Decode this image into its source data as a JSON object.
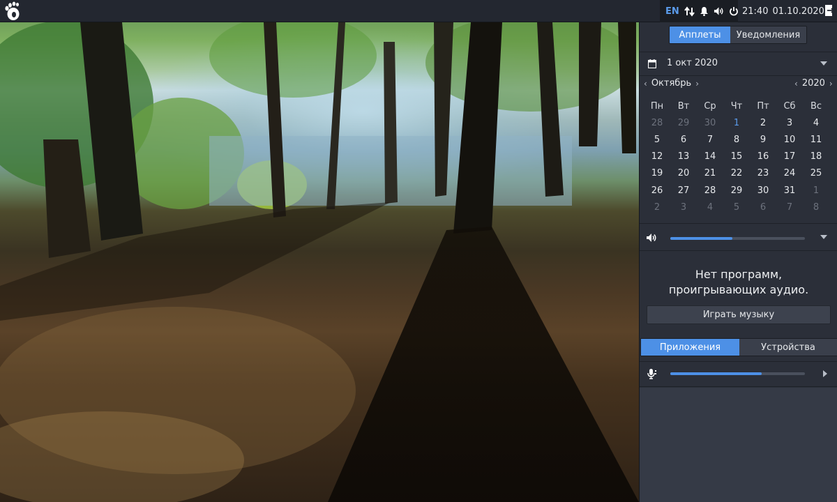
{
  "topbar": {
    "keyboard_layout": "EN",
    "time": "21:40",
    "date": "01.10.2020",
    "icons": [
      "gnome-foot-icon",
      "network-transfer-icon",
      "bell-icon",
      "volume-icon",
      "power-icon",
      "logout-icon"
    ]
  },
  "panel": {
    "tabs": [
      {
        "label": "Апплеты",
        "active": true
      },
      {
        "label": "Уведомления",
        "active": false
      }
    ],
    "calendar": {
      "selected_date": "1 окт 2020",
      "month": "Октябрь",
      "year": "2020",
      "weekdays": [
        "Пн",
        "Вт",
        "Ср",
        "Чт",
        "Пт",
        "Сб",
        "Вс"
      ],
      "weeks": [
        [
          {
            "d": "28",
            "s": "dim"
          },
          {
            "d": "29",
            "s": "dim"
          },
          {
            "d": "30",
            "s": "dim"
          },
          {
            "d": "1",
            "s": "today"
          },
          {
            "d": "2",
            "s": ""
          },
          {
            "d": "3",
            "s": ""
          },
          {
            "d": "4",
            "s": ""
          }
        ],
        [
          {
            "d": "5",
            "s": ""
          },
          {
            "d": "6",
            "s": ""
          },
          {
            "d": "7",
            "s": ""
          },
          {
            "d": "8",
            "s": ""
          },
          {
            "d": "9",
            "s": ""
          },
          {
            "d": "10",
            "s": ""
          },
          {
            "d": "11",
            "s": ""
          }
        ],
        [
          {
            "d": "12",
            "s": ""
          },
          {
            "d": "13",
            "s": ""
          },
          {
            "d": "14",
            "s": ""
          },
          {
            "d": "15",
            "s": ""
          },
          {
            "d": "16",
            "s": ""
          },
          {
            "d": "17",
            "s": ""
          },
          {
            "d": "18",
            "s": ""
          }
        ],
        [
          {
            "d": "19",
            "s": ""
          },
          {
            "d": "20",
            "s": ""
          },
          {
            "d": "21",
            "s": ""
          },
          {
            "d": "22",
            "s": ""
          },
          {
            "d": "23",
            "s": ""
          },
          {
            "d": "24",
            "s": ""
          },
          {
            "d": "25",
            "s": ""
          }
        ],
        [
          {
            "d": "26",
            "s": ""
          },
          {
            "d": "27",
            "s": ""
          },
          {
            "d": "28",
            "s": ""
          },
          {
            "d": "29",
            "s": ""
          },
          {
            "d": "30",
            "s": ""
          },
          {
            "d": "31",
            "s": ""
          },
          {
            "d": "1",
            "s": "dim"
          }
        ],
        [
          {
            "d": "2",
            "s": "dim"
          },
          {
            "d": "3",
            "s": "dim"
          },
          {
            "d": "4",
            "s": "dim"
          },
          {
            "d": "5",
            "s": "dim"
          },
          {
            "d": "6",
            "s": "dim"
          },
          {
            "d": "7",
            "s": "dim"
          },
          {
            "d": "8",
            "s": "dim"
          }
        ]
      ]
    },
    "volume": {
      "level": 0.46
    },
    "media": {
      "message_line1": "Нет программ,",
      "message_line2": "проигрывающих аудио.",
      "play_label": "Играть музыку"
    },
    "mixer_tabs": [
      {
        "label": "Приложения",
        "active": true
      },
      {
        "label": "Устройства",
        "active": false
      }
    ],
    "microphone": {
      "level": 0.68
    }
  },
  "colors": {
    "accent": "#4d90e6",
    "panel_bg": "#2b2f39",
    "topbar_bg": "#232730",
    "today": "#5b9bea"
  }
}
